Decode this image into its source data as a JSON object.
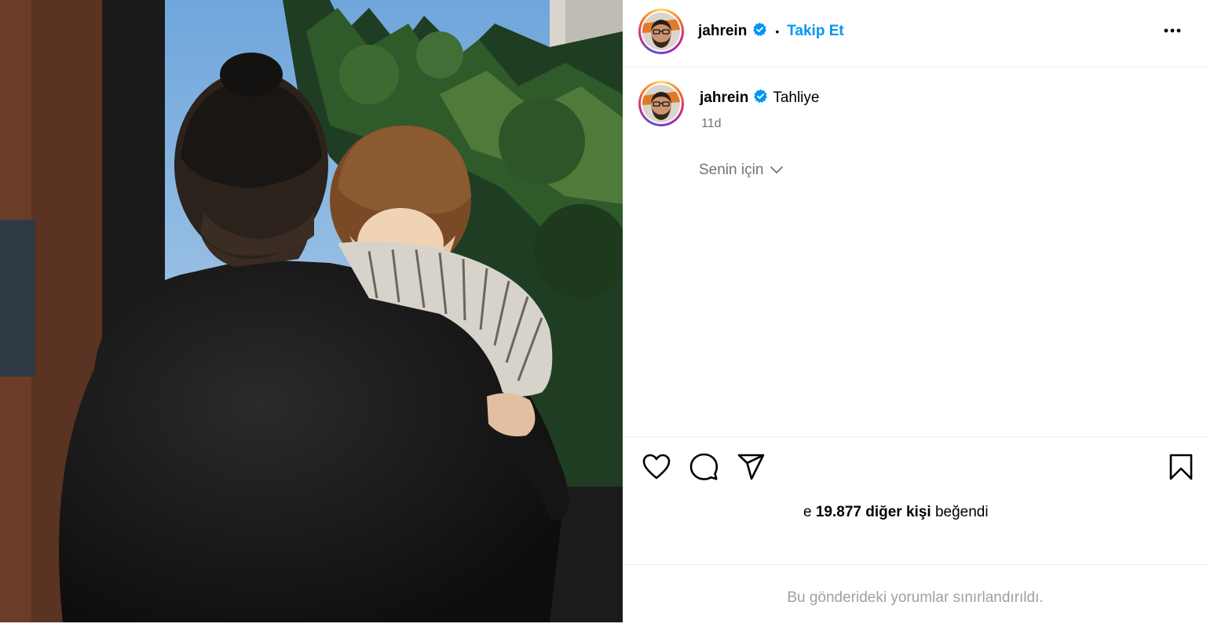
{
  "post_header": {
    "username": "jahrein",
    "follow_label": "Takip Et",
    "separator": "•",
    "more_icon": "more-horizontal-icon",
    "verified_icon": "verified-badge-icon"
  },
  "caption": {
    "username": "jahrein",
    "text": "Tahliye",
    "time": "11d",
    "translation_toggle": "Senin için"
  },
  "actions": {
    "like_icon": "heart-icon",
    "comment_icon": "comment-icon",
    "share_icon": "share-icon",
    "save_icon": "bookmark-icon"
  },
  "likes": {
    "prefix": "e ",
    "count": "19.877 diğer kişi",
    "suffix": " beğendi"
  },
  "comments_restricted": "Bu gönderideki yorumlar sınırlandırıldı.",
  "colors": {
    "link_blue": "#0095f6",
    "verified_blue": "#0095f6",
    "muted_text": "#737373",
    "divider": "#efefef"
  }
}
